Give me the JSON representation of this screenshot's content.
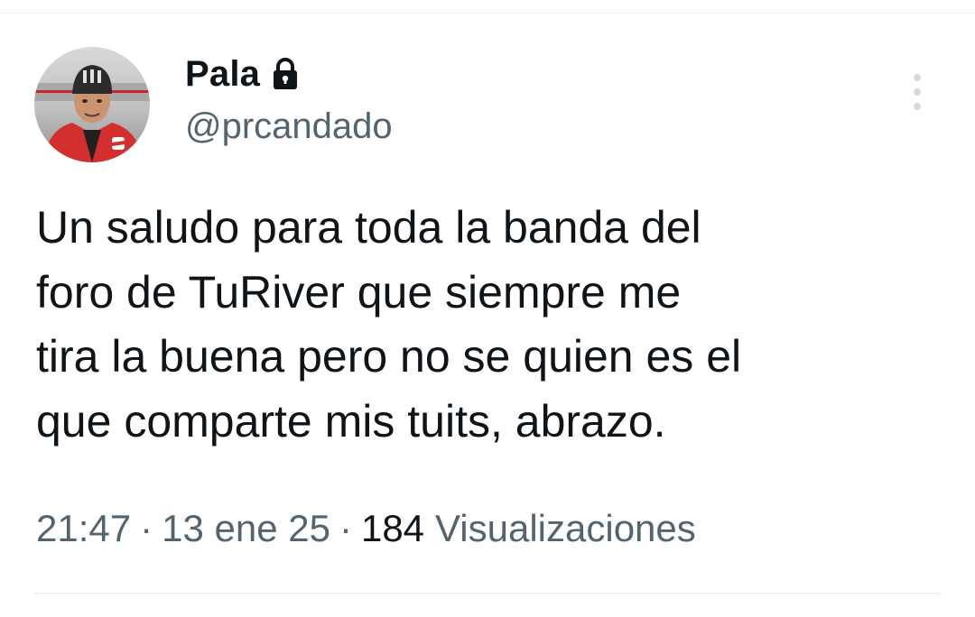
{
  "tweet": {
    "author": {
      "display_name": "Pala",
      "handle": "@prcandado",
      "protected_icon": "lock-icon",
      "avatar_icon": "profile-photo"
    },
    "text_lines": [
      "Un saludo para toda la banda del",
      "foro de TuRiver que siempre me",
      "tira la buena pero no se quien es el",
      "que comparte mis tuits, abrazo."
    ],
    "meta": {
      "time": "21:47",
      "separator": "·",
      "date": "13 ene 25",
      "views_count": "184",
      "views_label": "Visualizaciones"
    },
    "more_icon": "more-vertical-icon"
  },
  "colors": {
    "text_primary": "#0f1419",
    "text_secondary": "#536471",
    "divider": "#eff3f4",
    "background": "#ffffff"
  }
}
